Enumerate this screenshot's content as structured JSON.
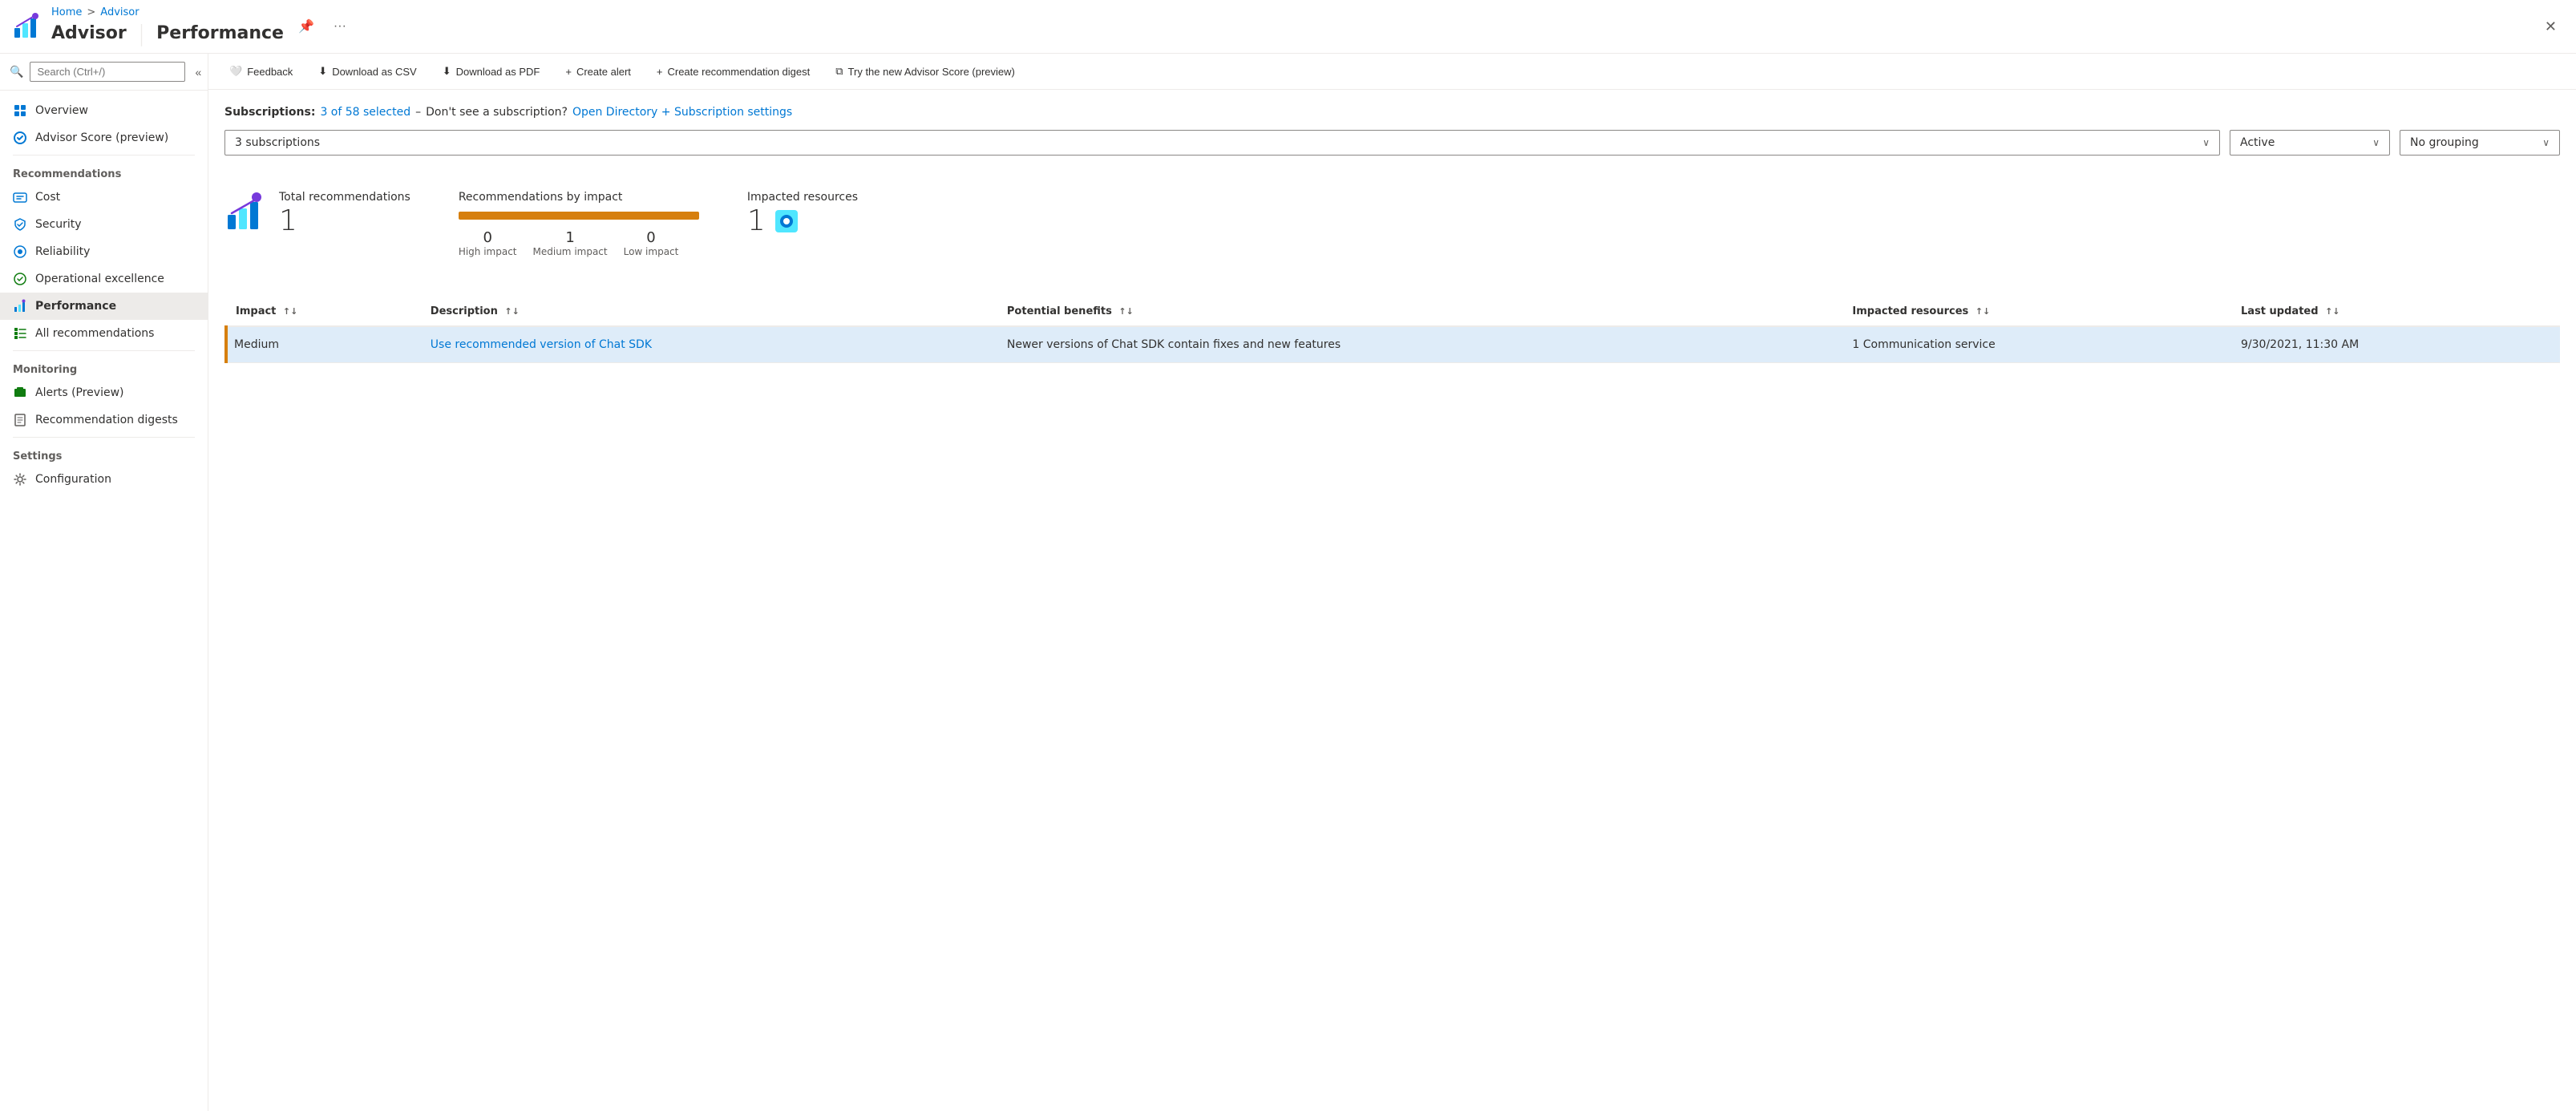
{
  "breadcrumb": {
    "home": "Home",
    "separator": ">",
    "current": "Advisor"
  },
  "title": {
    "app": "Advisor",
    "separator": "|",
    "page": "Performance",
    "pin_label": "Pin",
    "more_label": "More options",
    "close_label": "Close"
  },
  "toolbar": {
    "feedback": "Feedback",
    "download_csv": "Download as CSV",
    "download_pdf": "Download as PDF",
    "create_alert": "Create alert",
    "create_digest": "Create recommendation digest",
    "try_score": "Try the new Advisor Score (preview)"
  },
  "subscriptions": {
    "label": "Subscriptions:",
    "selected": "3 of 58 selected",
    "dash": "–",
    "dont_see": "Don't see a subscription?",
    "link_text": "Open Directory + Subscription settings"
  },
  "filters": {
    "subscription_value": "3 subscriptions",
    "status_value": "Active",
    "grouping_value": "No grouping"
  },
  "summary": {
    "total_label": "Total recommendations",
    "total_count": "1",
    "impact_label": "Recommendations by impact",
    "high_count": "0",
    "high_label": "High impact",
    "medium_count": "1",
    "medium_label": "Medium impact",
    "low_count": "0",
    "low_label": "Low impact",
    "resources_label": "Impacted resources",
    "resources_count": "1"
  },
  "table": {
    "columns": [
      {
        "id": "impact",
        "label": "Impact",
        "sortable": true
      },
      {
        "id": "description",
        "label": "Description",
        "sortable": true
      },
      {
        "id": "benefits",
        "label": "Potential benefits",
        "sortable": true
      },
      {
        "id": "resources",
        "label": "Impacted resources",
        "sortable": true
      },
      {
        "id": "updated",
        "label": "Last updated",
        "sortable": true
      }
    ],
    "rows": [
      {
        "impact": "Medium",
        "description": "Use recommended version of Chat SDK",
        "benefits": "Newer versions of Chat SDK contain fixes and new features",
        "resources": "1 Communication service",
        "updated": "9/30/2021, 11:30 AM"
      }
    ]
  },
  "sidebar": {
    "search_placeholder": "Search (Ctrl+/)",
    "nav_items": [
      {
        "id": "overview",
        "label": "Overview",
        "icon": "overview"
      },
      {
        "id": "advisor-score",
        "label": "Advisor Score (preview)",
        "icon": "advisor-score"
      }
    ],
    "sections": [
      {
        "label": "Recommendations",
        "items": [
          {
            "id": "cost",
            "label": "Cost",
            "icon": "cost"
          },
          {
            "id": "security",
            "label": "Security",
            "icon": "security"
          },
          {
            "id": "reliability",
            "label": "Reliability",
            "icon": "reliability"
          },
          {
            "id": "operational",
            "label": "Operational excellence",
            "icon": "operational"
          },
          {
            "id": "performance",
            "label": "Performance",
            "icon": "performance",
            "active": true
          },
          {
            "id": "all-recs",
            "label": "All recommendations",
            "icon": "all-recs"
          }
        ]
      },
      {
        "label": "Monitoring",
        "items": [
          {
            "id": "alerts",
            "label": "Alerts (Preview)",
            "icon": "alerts"
          },
          {
            "id": "rec-digests",
            "label": "Recommendation digests",
            "icon": "rec-digests"
          }
        ]
      },
      {
        "label": "Settings",
        "items": [
          {
            "id": "configuration",
            "label": "Configuration",
            "icon": "config"
          }
        ]
      }
    ]
  }
}
